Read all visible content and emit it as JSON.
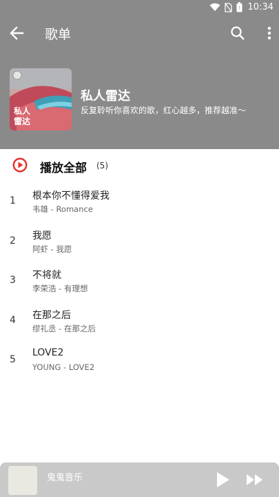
{
  "status_bar": {
    "time": "10:34"
  },
  "toolbar": {
    "title": "歌单"
  },
  "playlist": {
    "name": "私人雷达",
    "description": "反复聆听你喜欢的歌，红心越多，推荐越准～",
    "cover_text": "私人\n雷达"
  },
  "play_all": {
    "label": "播放全部",
    "count": "(5)"
  },
  "songs": [
    {
      "index": "1",
      "title": "根本你不懂得爱我",
      "subtitle": "韦雄 - Romance"
    },
    {
      "index": "2",
      "title": "我愿",
      "subtitle": "阿虾 - 我愿"
    },
    {
      "index": "3",
      "title": "不将就",
      "subtitle": "李荣浩 - 有理想"
    },
    {
      "index": "4",
      "title": "在那之后",
      "subtitle": "缪礼丞 - 在那之后"
    },
    {
      "index": "5",
      "title": "LOVE2",
      "subtitle": "YOUNG - LOVE2"
    }
  ],
  "mini_player": {
    "title": "鬼鬼音乐"
  },
  "colors": {
    "header_bg": "#8a8a8a",
    "accent_red": "#e8322b",
    "mini_bg": "#c9c9c9"
  }
}
